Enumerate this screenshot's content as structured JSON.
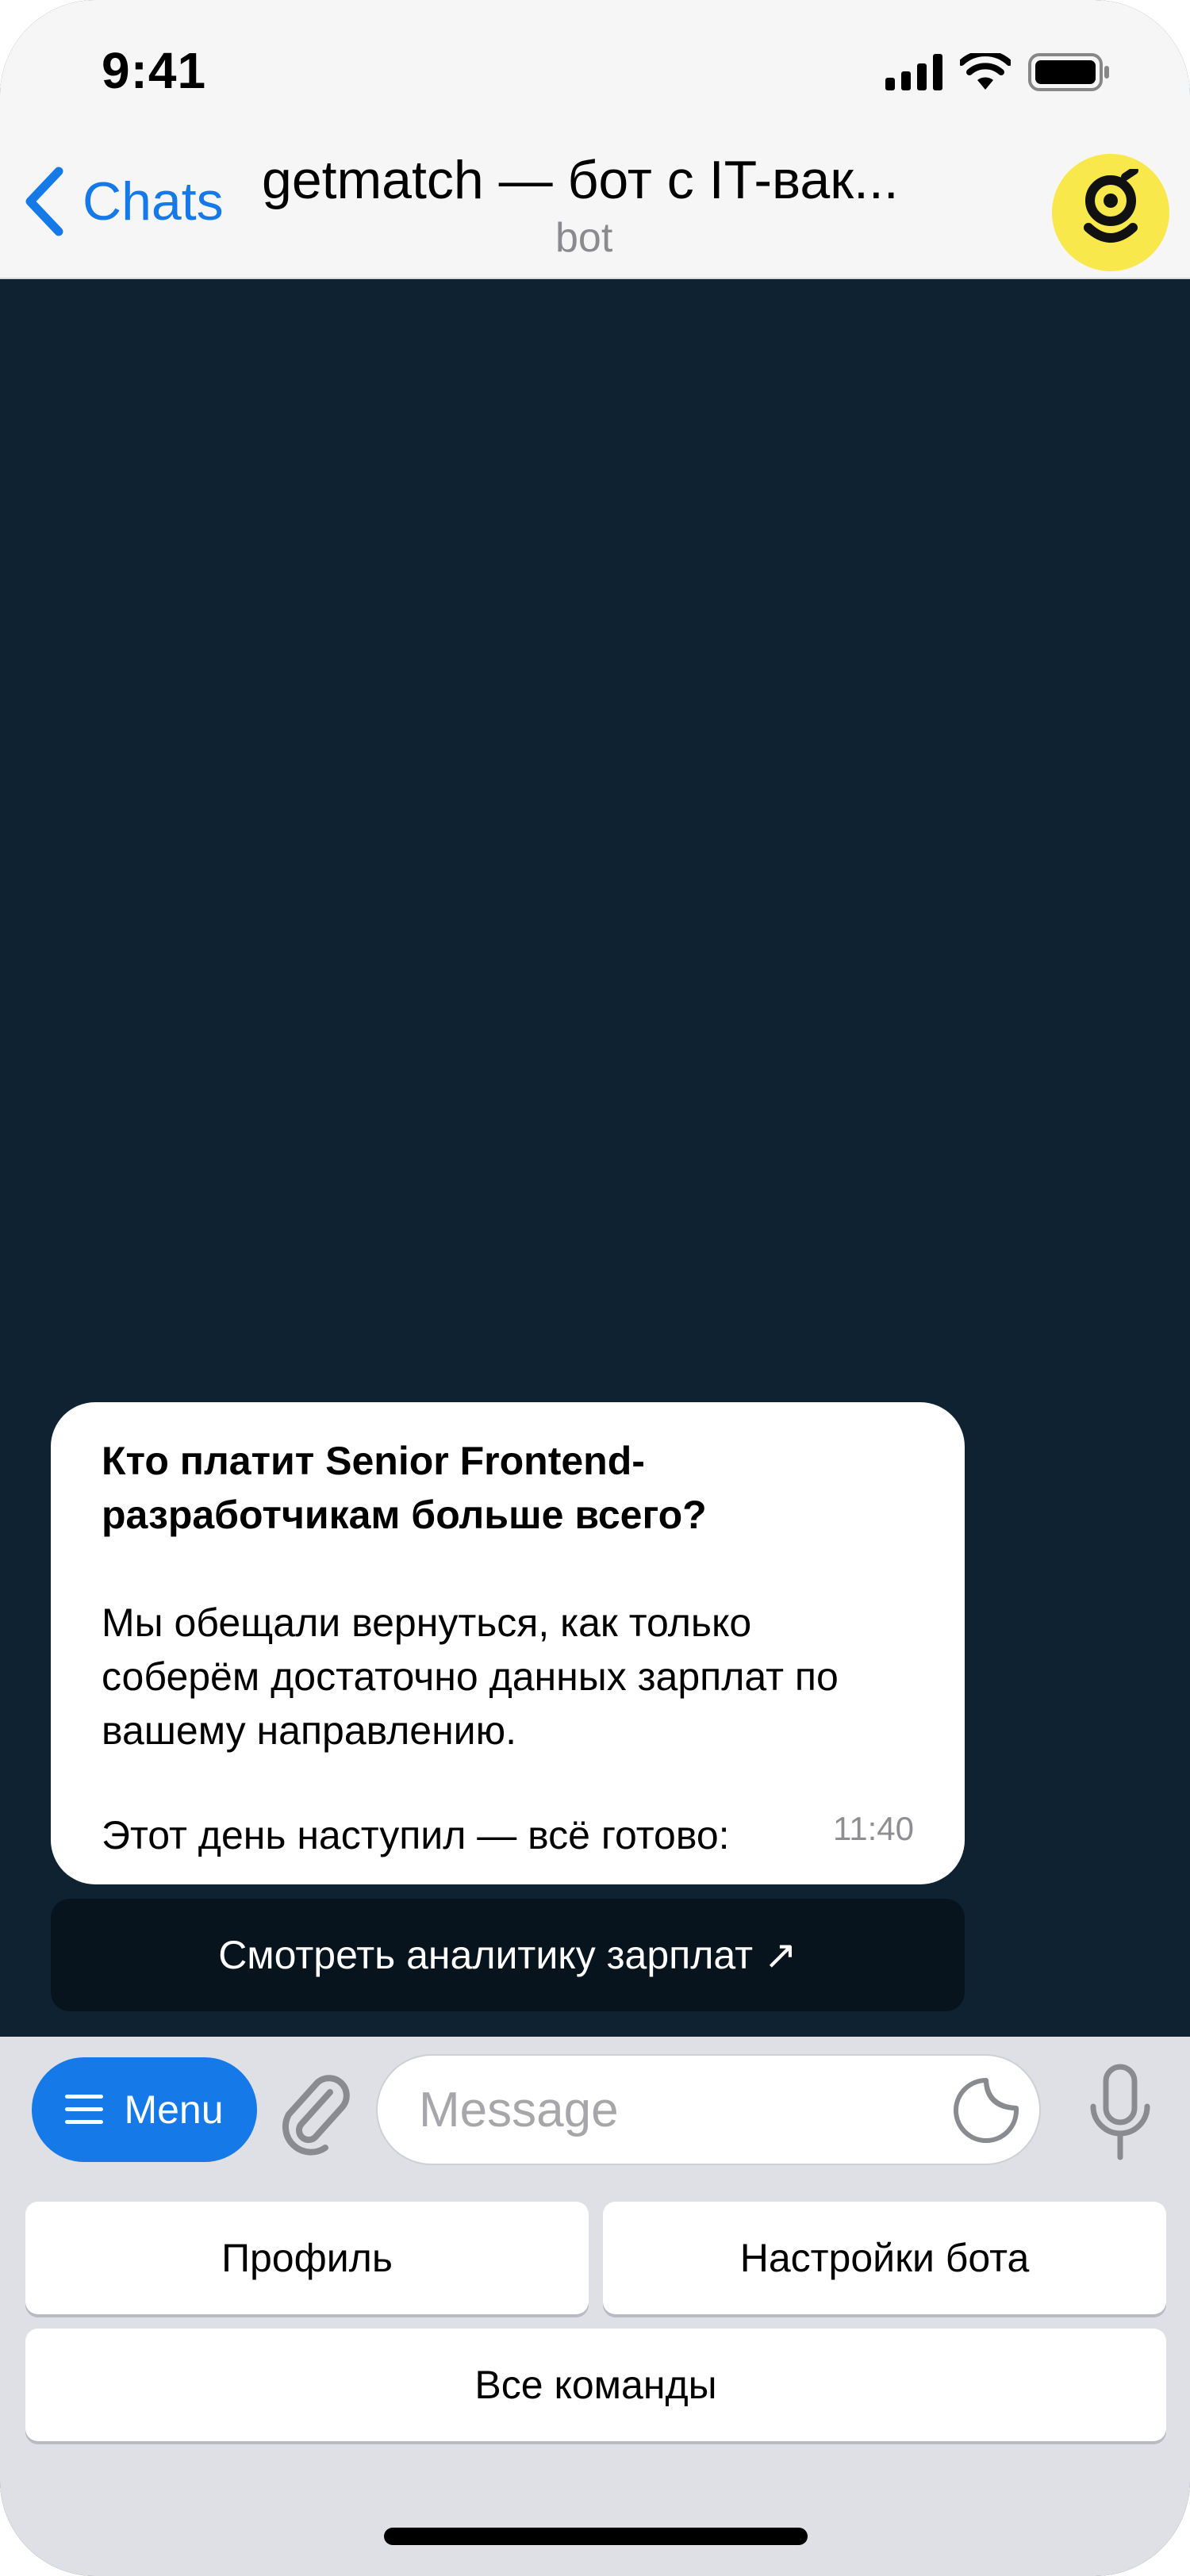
{
  "status_bar": {
    "time": "9:41"
  },
  "header": {
    "back_label": "Chats",
    "title": "getmatch — бот с IT-вак...",
    "subtitle": "bot",
    "avatar_icon": "getmatch-logo-icon",
    "avatar_color": "#f8e84c"
  },
  "message": {
    "title": "Кто платит Senior Frontend-разработчикам больше всего?",
    "body": "Мы обещали вернуться, как только соберём достаточно данных зарплат по вашему направлению.",
    "last_line": "Этот день наступил — всё готово:",
    "time": "11:40",
    "button_label": "Смотреть аналитику зарплат ↗"
  },
  "composer": {
    "menu_label": "Menu",
    "input_placeholder": "Message",
    "input_value": ""
  },
  "keyboard": {
    "buttons": [
      "Профиль",
      "Настройки бота",
      "Все команды"
    ]
  },
  "colors": {
    "accent": "#1679e8",
    "chat_background": "#0f2232",
    "inline_button": "#08141d"
  }
}
